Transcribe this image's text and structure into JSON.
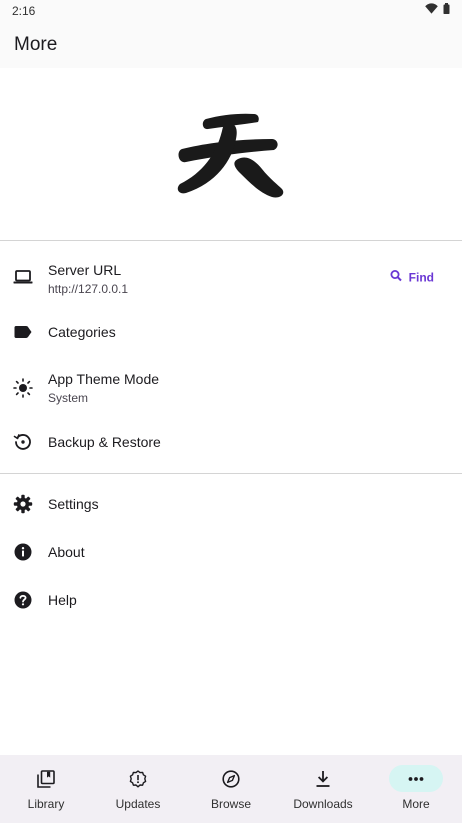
{
  "status": {
    "time": "2:16",
    "icons": [
      "wifi-icon",
      "battery-icon"
    ]
  },
  "header": {
    "title": "More"
  },
  "logo": {
    "icon": "kanji-logo",
    "glyph": "天"
  },
  "menu": {
    "server": {
      "title": "Server URL",
      "subtitle": "http://127.0.0.1",
      "icon": "laptop-icon",
      "action_label": "Find",
      "action_icon": "search-icon"
    },
    "categories": {
      "title": "Categories",
      "icon": "label-icon"
    },
    "theme": {
      "title": "App Theme Mode",
      "subtitle": "System",
      "icon": "brightness-icon"
    },
    "backup": {
      "title": "Backup & Restore",
      "icon": "restore-icon"
    },
    "settings": {
      "title": "Settings",
      "icon": "gear-icon"
    },
    "about": {
      "title": "About",
      "icon": "info-icon"
    },
    "help": {
      "title": "Help",
      "icon": "help-icon"
    }
  },
  "nav": {
    "items": [
      {
        "label": "Library",
        "icon": "library-icon",
        "active": false
      },
      {
        "label": "Updates",
        "icon": "updates-icon",
        "active": false
      },
      {
        "label": "Browse",
        "icon": "compass-icon",
        "active": false
      },
      {
        "label": "Downloads",
        "icon": "download-icon",
        "active": false
      },
      {
        "label": "More",
        "icon": "more-horiz-icon",
        "active": true
      }
    ]
  },
  "colors": {
    "accent": "#6a37d4",
    "active_pill": "#d6f5f3",
    "nav_background": "#f2eff4",
    "divider": "#d4d4d4"
  }
}
